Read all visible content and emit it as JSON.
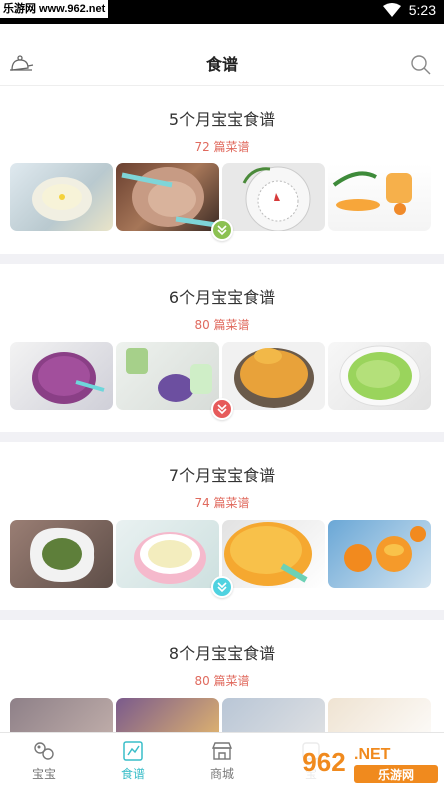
{
  "status_bar": {
    "watermark": "乐游网 www.962.net",
    "time": "5:23"
  },
  "header": {
    "title": "食谱",
    "left_icon": "baby-cap-icon",
    "right_icon": "search-icon"
  },
  "sections": [
    {
      "title": "5个月宝宝食谱",
      "count": "72 篇菜谱",
      "expand_color": "#8cc152"
    },
    {
      "title": "6个月宝宝食谱",
      "count": "80 篇菜谱",
      "expand_color": "#e65a5a"
    },
    {
      "title": "7个月宝宝食谱",
      "count": "74 篇菜谱",
      "expand_color": "#4fd2e0"
    },
    {
      "title": "8个月宝宝食谱",
      "count": "80 篇菜谱"
    }
  ],
  "tabs": [
    {
      "label": "宝宝",
      "icon": "baby-icon"
    },
    {
      "label": "食谱",
      "icon": "recipe-icon",
      "active": true
    },
    {
      "label": "商城",
      "icon": "store-icon"
    },
    {
      "label": "宝",
      "icon": "profile-icon"
    }
  ],
  "colors": {
    "accent": "#39bdc8",
    "count_text": "#e06a5e",
    "divider": "#f1f1f5"
  },
  "watermark_br": {
    "number": "962",
    "suffix": ".NET",
    "brand": "乐游网"
  }
}
